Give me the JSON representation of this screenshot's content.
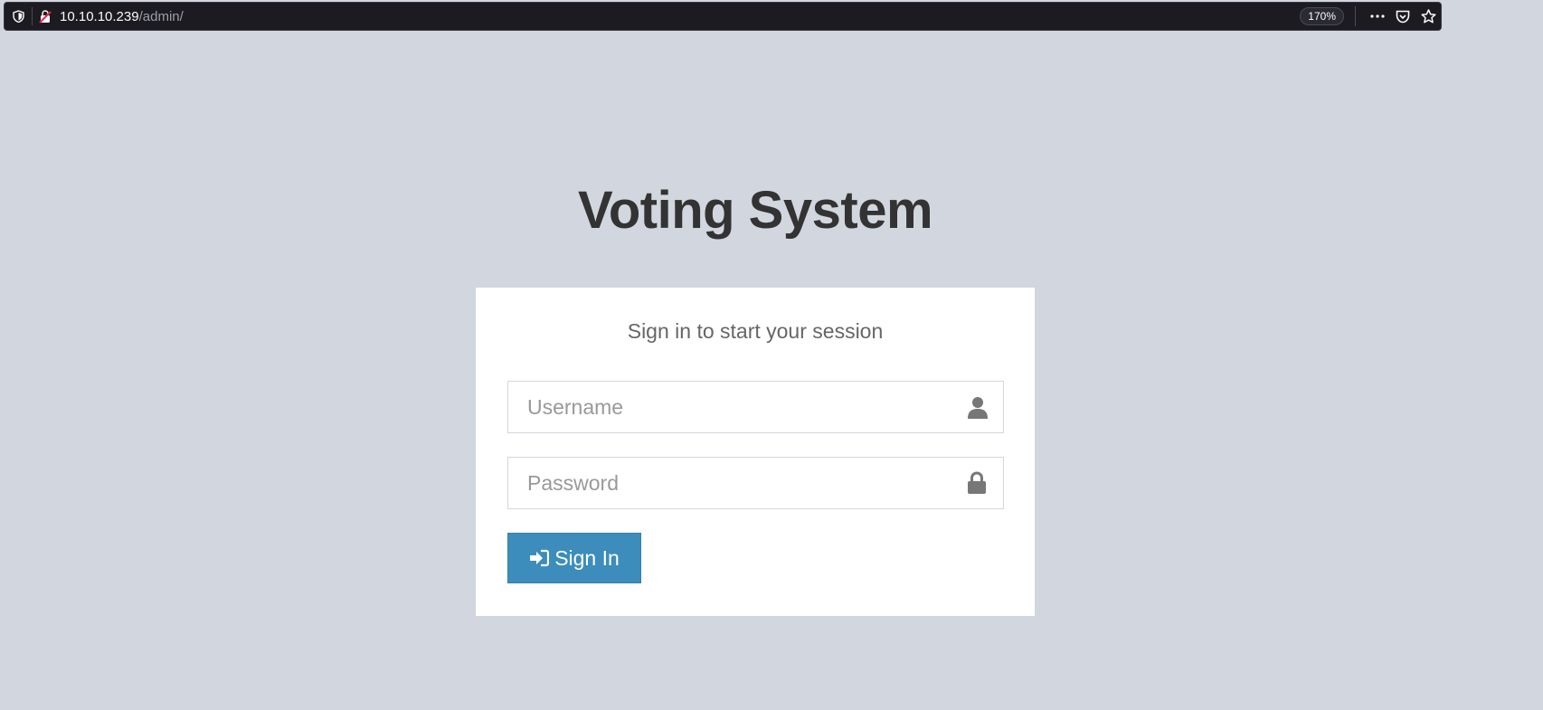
{
  "browser": {
    "url_host": "10.10.10.239",
    "url_path": "/admin/",
    "zoom": "170%"
  },
  "page": {
    "title": "Voting System",
    "login_message": "Sign in to start your session",
    "username_placeholder": "Username",
    "password_placeholder": "Password",
    "signin_label": "Sign In",
    "accent_color": "#3c8dbc",
    "background_color": "#d2d6de"
  },
  "icons": {
    "username": "user-icon",
    "password": "lock-icon",
    "signin": "sign-in-icon"
  }
}
